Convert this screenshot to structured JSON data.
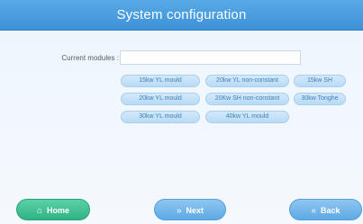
{
  "window": {
    "title": "System configuration"
  },
  "form": {
    "current_modules_label": "Current modules :",
    "current_modules_value": "",
    "current_modules_placeholder": ""
  },
  "modules": [
    "15kw YL mould",
    "20kw YL non-constant",
    "15kw SH",
    "20kw YL mould",
    "20Kw SH non-constant",
    "30kw Tonghe",
    "30kw YL mould",
    "40kw YL mould"
  ],
  "footer": {
    "home_label": "Home",
    "home_icon": "home-icon",
    "next_label": "Next",
    "next_icon": "double-chevron-right-icon",
    "back_label": "Back",
    "back_icon": "double-chevron-left-icon"
  },
  "colors": {
    "header": "#4a9fe0",
    "chip_bg": "#c6e1f8",
    "chip_text": "#3f7fb8",
    "home_button": "#3cc394",
    "nav_button": "#74b7ec"
  }
}
